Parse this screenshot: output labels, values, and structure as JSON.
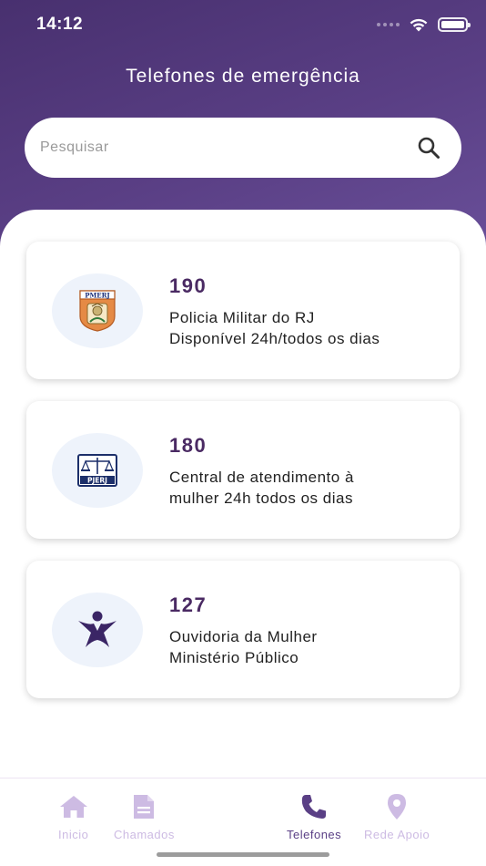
{
  "status_bar": {
    "time": "14:12"
  },
  "header": {
    "title": "Telefones de emergência"
  },
  "search": {
    "placeholder": "Pesquisar",
    "value": ""
  },
  "cards": [
    {
      "number": "190",
      "line1": "Policia Militar do RJ",
      "line2": "Disponível 24h/todos os dias",
      "logo": "pmerj-badge",
      "logo_text": "PMERJ"
    },
    {
      "number": "180",
      "line1": "Central de atendimento à",
      "line2": "mulher 24h todos os dias",
      "logo": "pjerj-scales",
      "logo_text": "PJERJ"
    },
    {
      "number": "127",
      "line1": "Ouvidoria da Mulher",
      "line2": "Ministério Público",
      "logo": "woman-figure"
    }
  ],
  "tabbar": {
    "items": [
      {
        "label": "Inicio",
        "icon": "home-icon",
        "active": false
      },
      {
        "label": "Chamados",
        "icon": "document-icon",
        "active": false
      },
      {
        "label": "Telefones",
        "icon": "phone-icon",
        "active": true
      },
      {
        "label": "Rede Apoio",
        "icon": "location-pin-icon",
        "active": false
      }
    ]
  },
  "colors": {
    "header_top": "#48306f",
    "header_bottom": "#6a509a",
    "number_text": "#4a2a63",
    "logo_bg": "#eef3fb",
    "tab_active": "#5a3f85",
    "tab_inactive": "#cdbbe3"
  }
}
